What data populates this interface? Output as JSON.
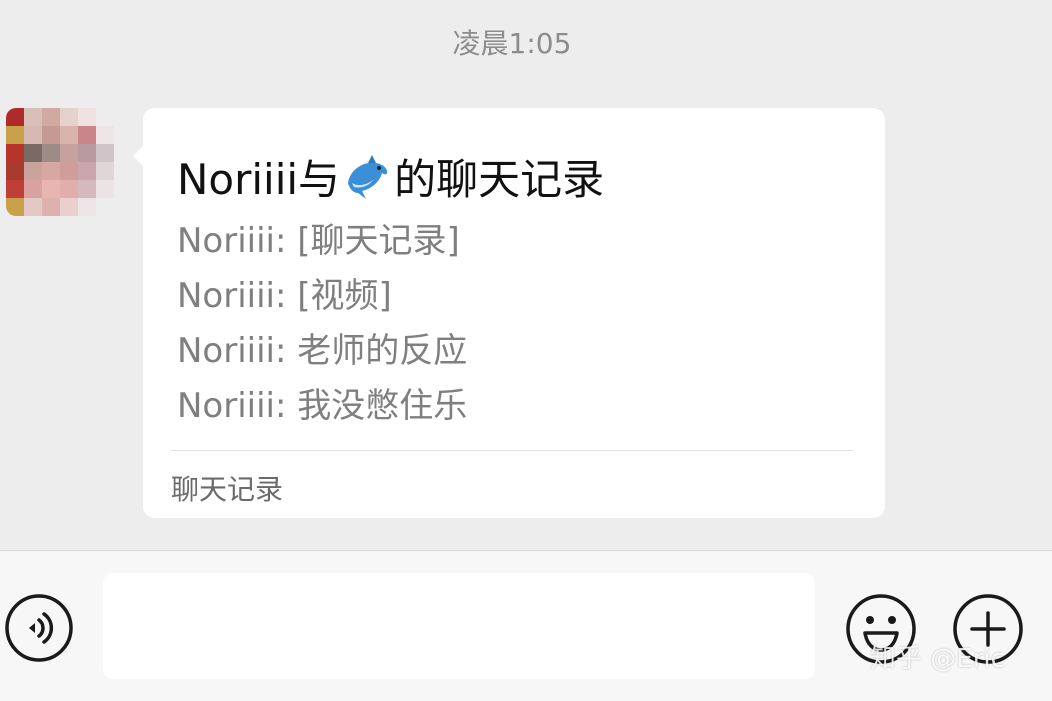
{
  "timestamp": "凌晨1:05",
  "message_card": {
    "title_prefix": "Noriiii与",
    "title_suffix": "的聊天记录",
    "title_icon": "dolphin-emoji",
    "lines": [
      "Noriiii: [聊天记录]",
      "Noriiii: [视频]",
      "Noriiii: 老师的反应",
      "Noriiii: 我没憋住乐"
    ],
    "footer_label": "聊天记录"
  },
  "input_bar": {
    "voice_icon": "voice-icon",
    "text_value": "",
    "emoji_icon": "smiley-icon",
    "plus_icon": "plus-icon"
  },
  "watermark": "知乎 @Eric",
  "colors": {
    "background": "#ededed",
    "bubble": "#ffffff",
    "muted_text": "#7f7f7f",
    "bottom_bar": "#f7f7f7"
  }
}
